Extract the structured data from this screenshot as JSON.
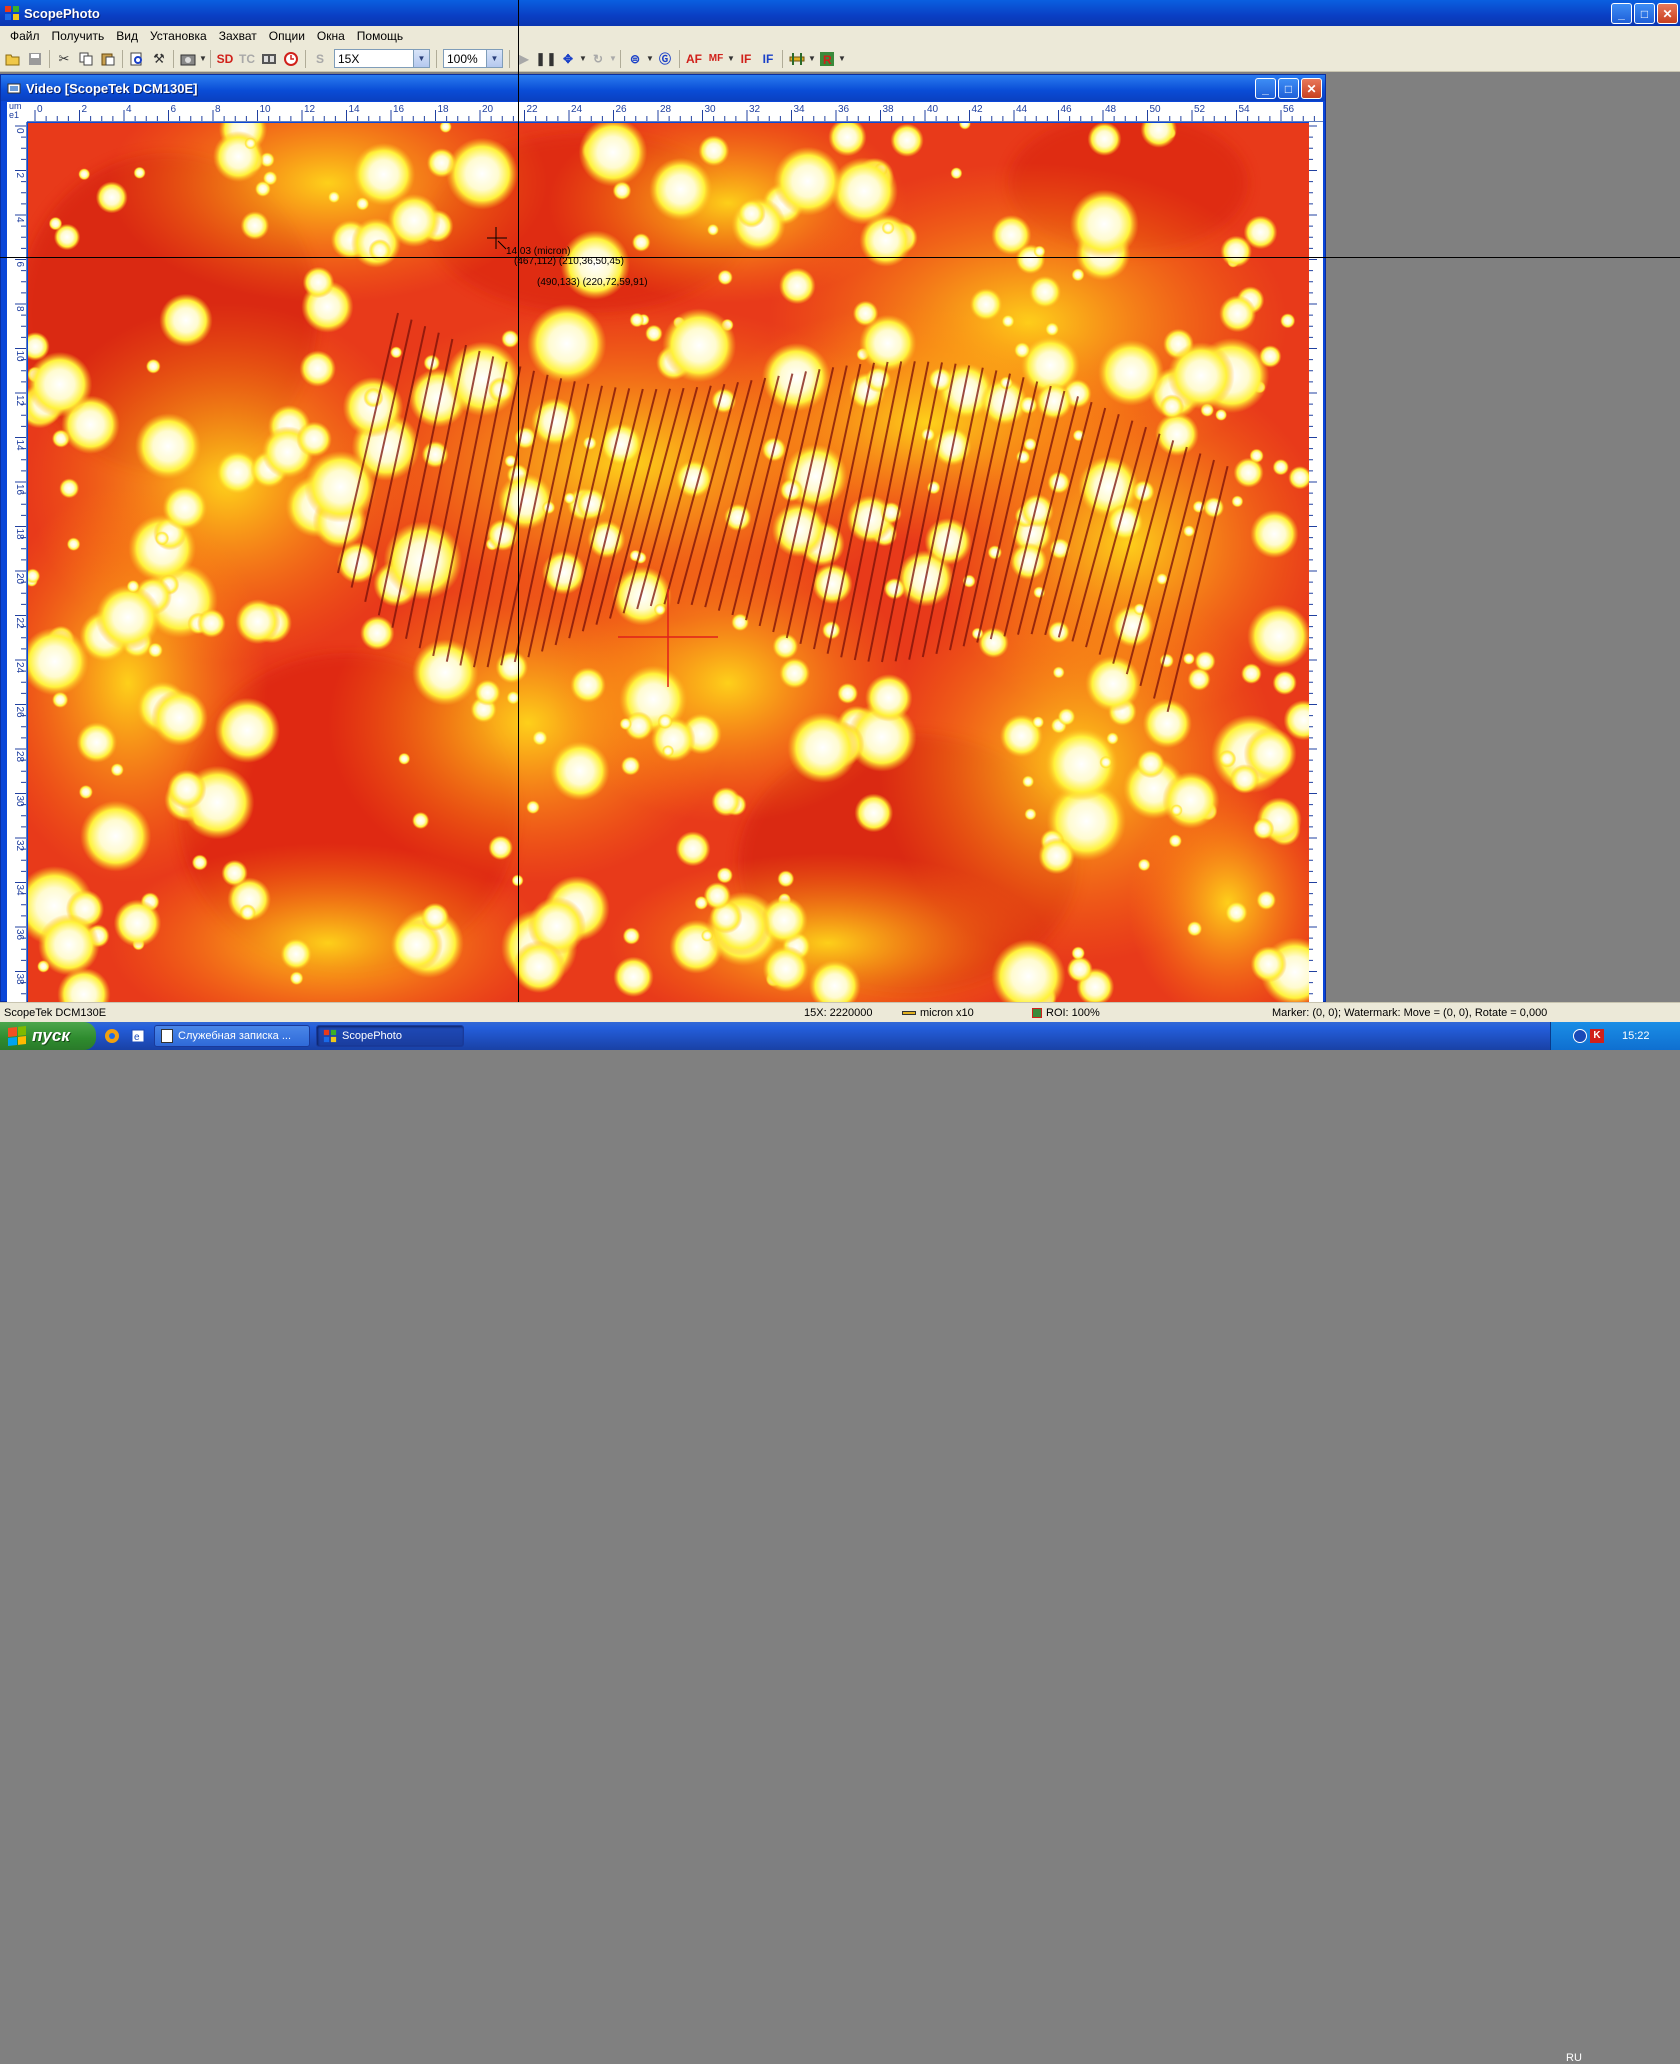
{
  "app": {
    "title": "ScopePhoto",
    "controls": {
      "minimize": "_",
      "maximize": "□",
      "close": "✕"
    }
  },
  "menu": [
    "Файл",
    "Получить",
    "Вид",
    "Установка",
    "Захват",
    "Опции",
    "Окна",
    "Помощь"
  ],
  "toolbar": {
    "labels": {
      "sd": "SD",
      "tc": "TC",
      "s": "S",
      "af": "AF",
      "mf": "MF",
      "if1": "IF",
      "if2": "IF"
    },
    "magnification": "15X",
    "zoom": "100%"
  },
  "video_window": {
    "title": "Video [ScopeTek DCM130E]",
    "ruler_unit": "um\ne1",
    "ruler_top_ticks": [
      "0",
      "2",
      "4",
      "6",
      "8",
      "10",
      "12",
      "14",
      "16",
      "18",
      "20",
      "22",
      "24",
      "26",
      "28",
      "30",
      "32",
      "34",
      "36",
      "38",
      "40",
      "42",
      "44",
      "46",
      "48",
      "50",
      "52",
      "54",
      "56"
    ],
    "ruler_left_ticks": [
      "0",
      "2",
      "4",
      "6",
      "8",
      "10",
      "12",
      "14",
      "16",
      "18",
      "20",
      "22",
      "24",
      "26",
      "28",
      "30",
      "32",
      "34",
      "36",
      "38"
    ]
  },
  "overlay": {
    "measure": "14.03 (micron)",
    "pixel1": "(467,112) (210,36,50,45)",
    "pixel2": "(490,133) (220,72,59,91)"
  },
  "status": {
    "device": "ScopeTek DCM130E",
    "mag": "15X: 2220000",
    "scale": "micron x10",
    "roi": "ROI: 100%",
    "marker": "Marker: (0, 0); Watermark: Move = (0, 0), Rotate = 0,000"
  },
  "taskbar": {
    "start": "пуск",
    "tasks": [
      "Служебная записка ...",
      "ScopePhoto"
    ],
    "lang": "RU",
    "clock": "15:22"
  },
  "colors": {
    "xp_blue": "#0a46d8",
    "image_red": "#e8301a",
    "image_yellow": "#fff23a"
  }
}
